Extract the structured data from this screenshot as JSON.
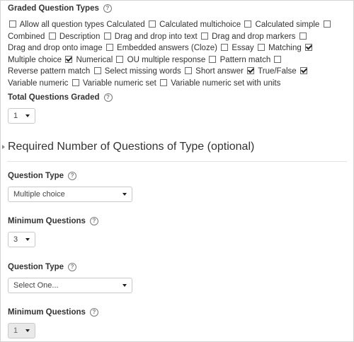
{
  "graded": {
    "label": "Graded Question Types",
    "options": [
      {
        "label": "Allow all question types",
        "checked": false
      },
      {
        "label": "Calculated",
        "checked": false
      },
      {
        "label": "Calculated multichoice",
        "checked": false
      },
      {
        "label": "Calculated simple",
        "checked": false
      },
      {
        "label": "Combined",
        "checked": false
      },
      {
        "label": "Description",
        "checked": false
      },
      {
        "label": "Drag and drop into text",
        "checked": false
      },
      {
        "label": "Drag and drop markers",
        "checked": false
      },
      {
        "label": "Drag and drop onto image",
        "checked": false
      },
      {
        "label": "Embedded answers (Cloze)",
        "checked": false
      },
      {
        "label": "Essay",
        "checked": false
      },
      {
        "label": "Matching",
        "checked": true
      },
      {
        "label": "Multiple choice",
        "checked": true
      },
      {
        "label": "Numerical",
        "checked": false
      },
      {
        "label": "OU multiple response",
        "checked": false
      },
      {
        "label": "Pattern match",
        "checked": false
      },
      {
        "label": "Reverse pattern match",
        "checked": false
      },
      {
        "label": "Select missing words",
        "checked": false
      },
      {
        "label": "Short answer",
        "checked": true
      },
      {
        "label": "True/False",
        "checked": true
      },
      {
        "label": "Variable numeric",
        "checked": false
      },
      {
        "label": "Variable numeric set",
        "checked": false
      },
      {
        "label": "Variable numeric set with units",
        "checked": null
      }
    ]
  },
  "total": {
    "label": "Total Questions Graded",
    "value": "1"
  },
  "section": {
    "title": "Required Number of Questions of Type (optional)"
  },
  "rows": [
    {
      "type_label": "Question Type",
      "type_value": "Multiple choice",
      "min_label": "Minimum Questions",
      "min_value": "3",
      "min_disabled": false
    },
    {
      "type_label": "Question Type",
      "type_value": "Select One...",
      "min_label": "Minimum Questions",
      "min_value": "1",
      "min_disabled": true
    }
  ],
  "icons": {
    "help": "?"
  }
}
